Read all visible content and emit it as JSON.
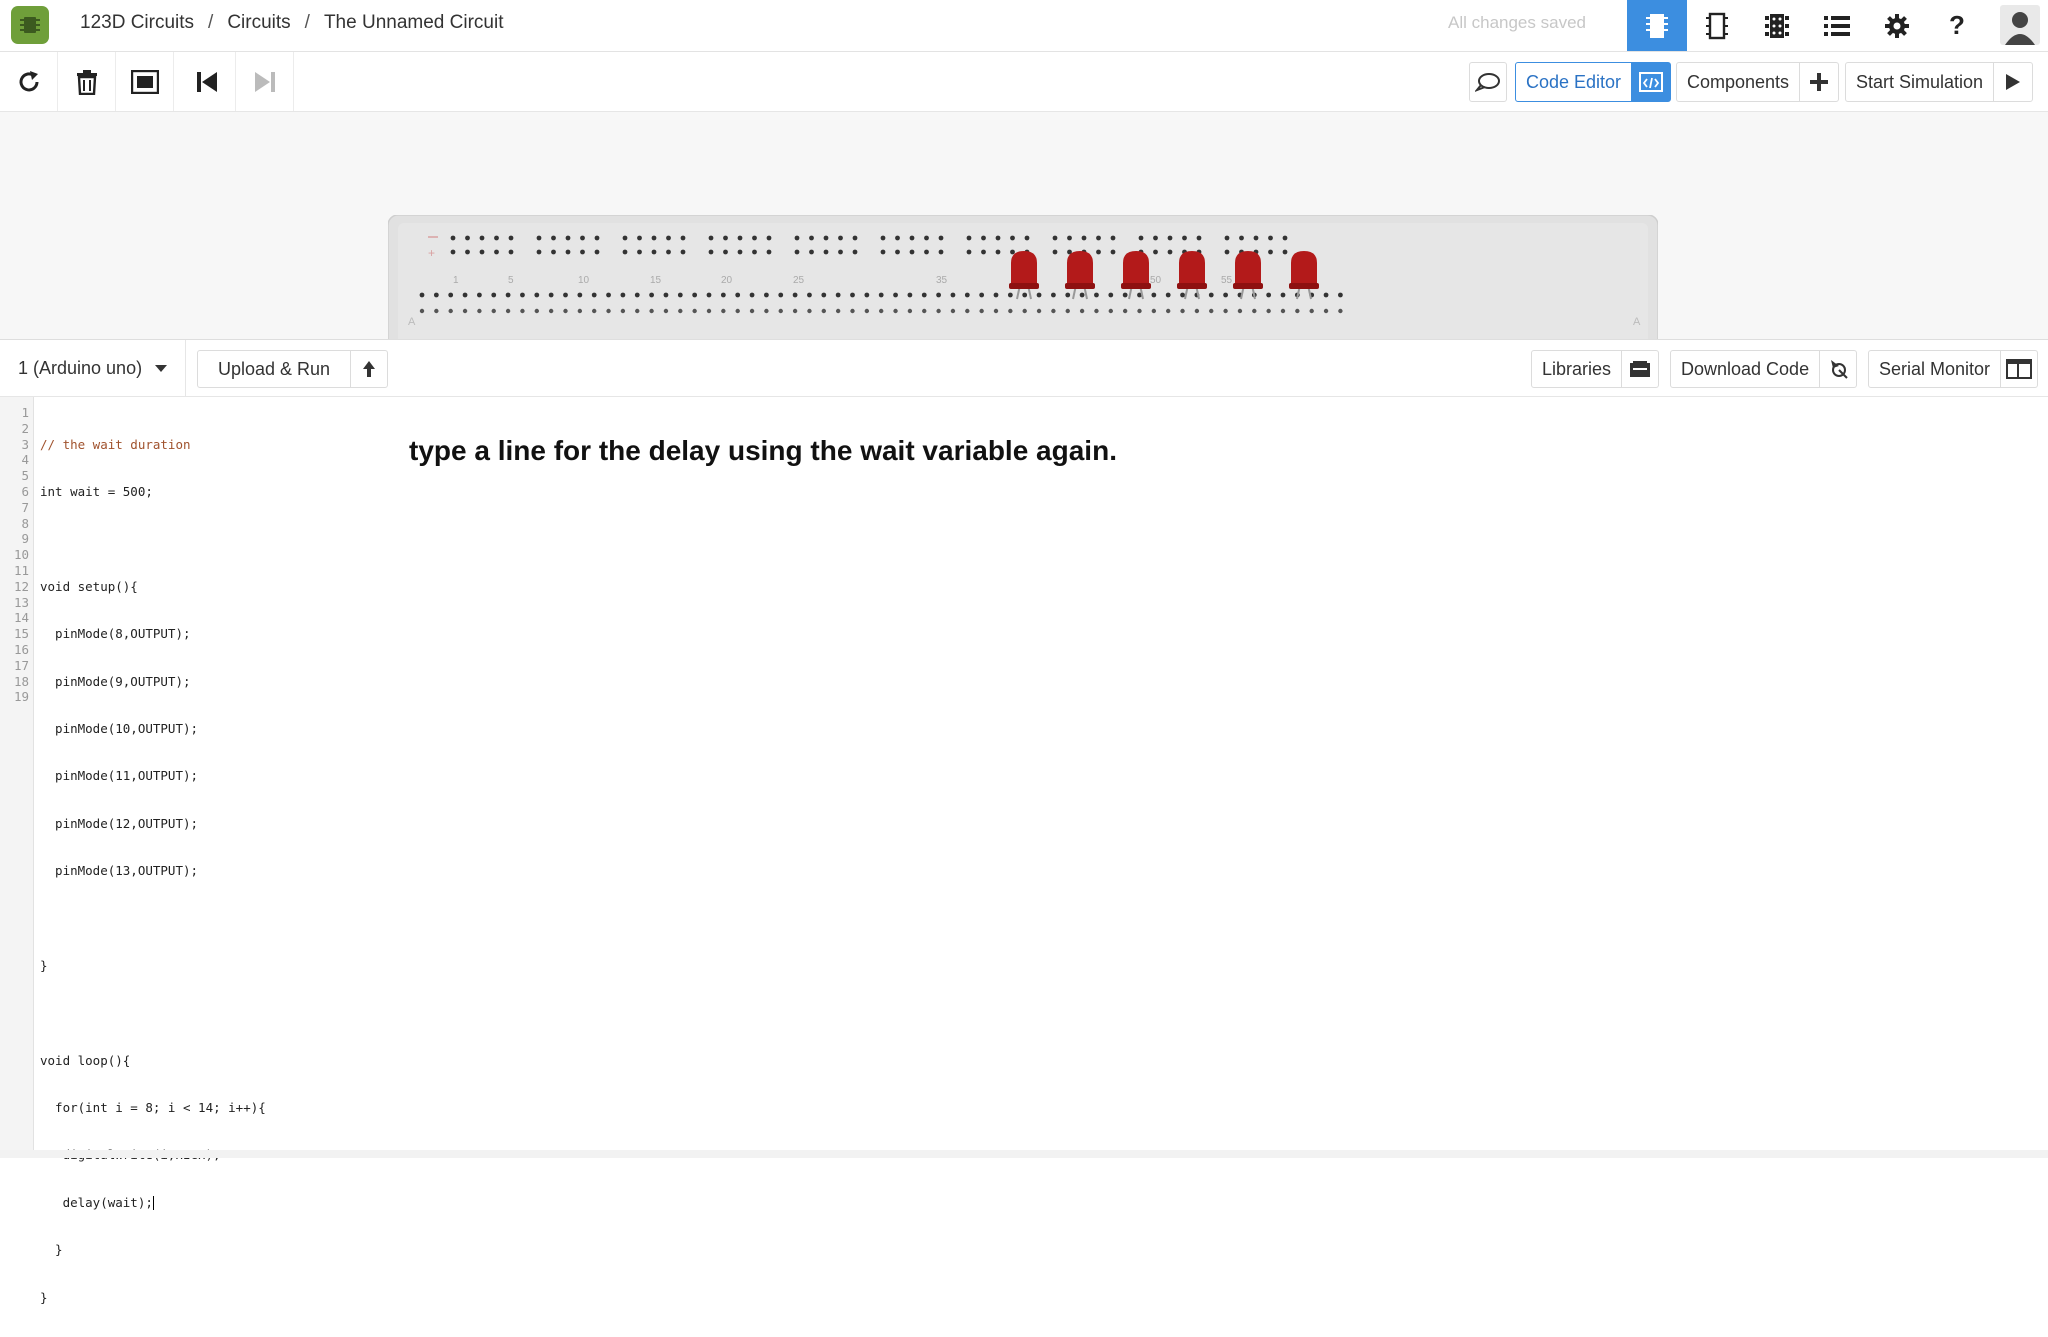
{
  "header": {
    "breadcrumbs": [
      "123D Circuits",
      "Circuits",
      "The Unnamed Circuit"
    ],
    "separator": "/",
    "save_status": "All changes saved",
    "icons": [
      "breadboard-view-icon",
      "schematic-view-icon",
      "pcb-view-icon",
      "component-list-icon",
      "settings-gear-icon",
      "help-icon",
      "user-avatar-icon"
    ],
    "help_glyph": "?"
  },
  "toolbar": {
    "left_tools": [
      "rotate-icon",
      "delete-icon",
      "fit-to-screen-icon",
      "step-back-icon",
      "step-forward-icon"
    ],
    "code_editor_label": "Code Editor",
    "components_label": "Components",
    "start_simulation_label": "Start Simulation"
  },
  "editor": {
    "device_select": "1 (Arduino uno)",
    "upload_run_label": "Upload & Run",
    "libraries_label": "Libraries",
    "download_code_label": "Download Code",
    "serial_monitor_label": "Serial Monitor",
    "line_numbers": "1\n2\n3\n4\n5\n6\n7\n8\n9\n10\n11\n12\n13\n14\n15\n16\n17\n18\n19",
    "code_lines": [
      "// the wait duration",
      "int wait = 500;",
      "",
      "void setup(){",
      "  pinMode(8,OUTPUT);",
      "  pinMode(9,OUTPUT);",
      "  pinMode(10,OUTPUT);",
      "  pinMode(11,OUTPUT);",
      "  pinMode(12,OUTPUT);",
      "  pinMode(13,OUTPUT);",
      "",
      "}",
      "",
      "void loop(){",
      "  for(int i = 8; i < 14; i++){",
      "   digitalWrite(i,HIGH);",
      "   delay(wait);",
      "  }",
      "}"
    ]
  },
  "breadboard": {
    "column_labels": [
      "1",
      "5",
      "10",
      "15",
      "20",
      "25",
      "35",
      "50",
      "55",
      "60"
    ],
    "led_count": 6,
    "led_color": "#b31a1a"
  },
  "overlay": {
    "instruction": "type a line for the delay using the wait variable again."
  },
  "colors": {
    "accent": "#3c8ee0",
    "logo": "#6f9f3a"
  }
}
